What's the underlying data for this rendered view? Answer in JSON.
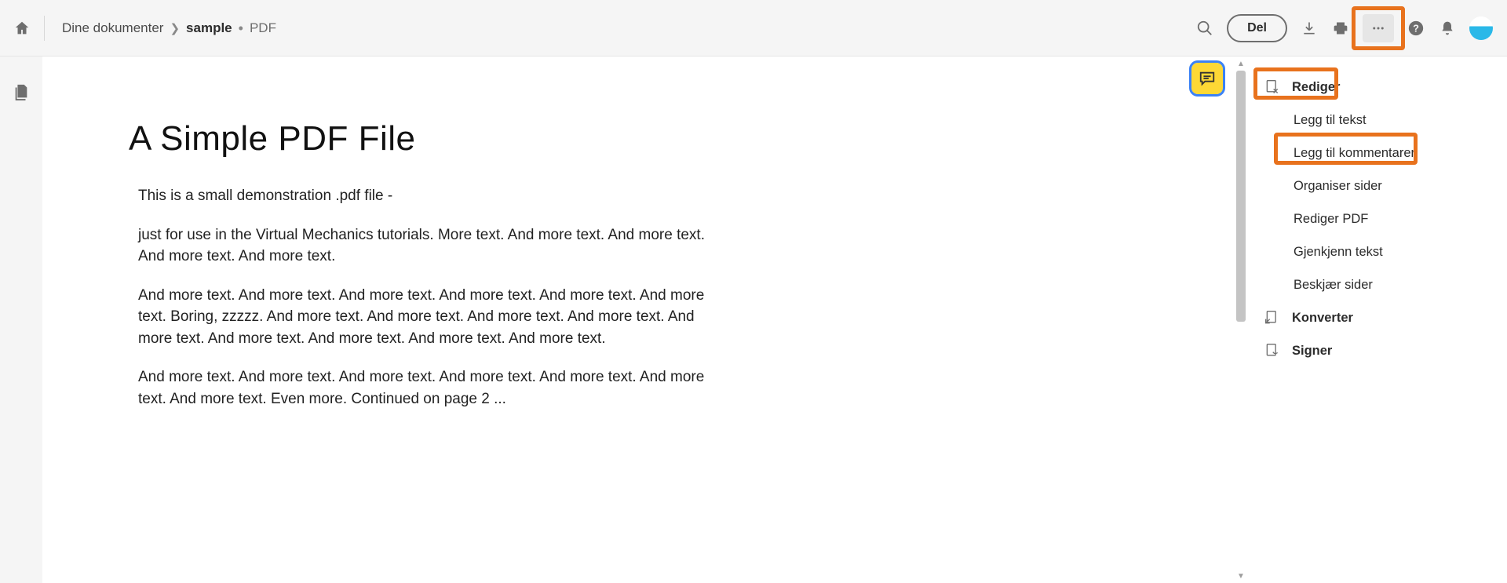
{
  "breadcrumb": {
    "root": "Dine dokumenter",
    "current": "sample",
    "type": "PDF"
  },
  "topbar": {
    "share_label": "Del"
  },
  "document": {
    "title": "A Simple PDF File",
    "paragraphs": [
      "This is a small demonstration .pdf file -",
      "just for use in the Virtual Mechanics tutorials. More text. And more text. And more text. And more text. And more text.",
      "And more text. And more text. And more text. And more text. And more text. And more text. Boring, zzzzz. And more text. And more text. And more text. And more text. And more text. And more text. And more text. And more text. And more text.",
      "And more text. And more text. And more text. And more text. And more text. And more text. And more text. Even more. Continued on page 2 ..."
    ]
  },
  "panel": {
    "rediger": "Rediger",
    "legg_til_tekst": "Legg til tekst",
    "legg_til_kommentarer": "Legg til kommentarer",
    "organiser_sider": "Organiser sider",
    "rediger_pdf": "Rediger PDF",
    "gjenkjenn_tekst": "Gjenkjenn tekst",
    "beskjaer_sider": "Beskjær sider",
    "konverter": "Konverter",
    "signer": "Signer"
  }
}
